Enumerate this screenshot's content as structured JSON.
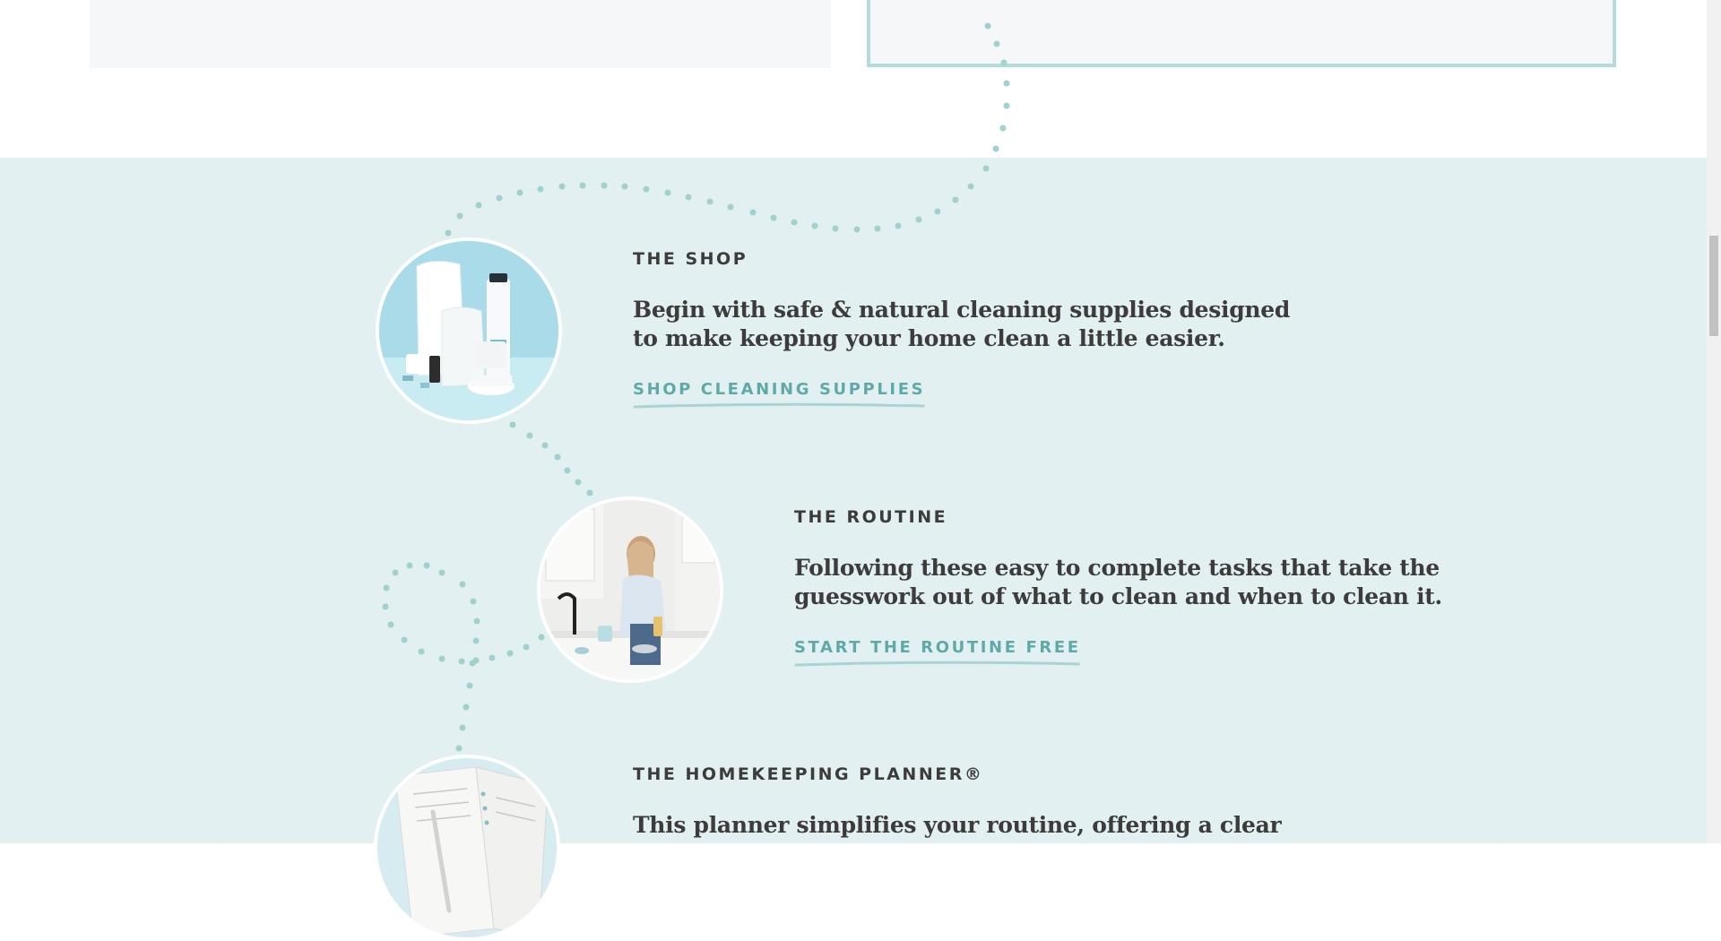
{
  "colors": {
    "section_bg": "#e2f0f1",
    "card_bg": "#f6f7f8",
    "card_border": "#b3dcdd",
    "dots": "#9fd1cf",
    "heading": "#3d3b3c",
    "link": "#5faaa9"
  },
  "steps": [
    {
      "eyebrow": "THE SHOP",
      "description_line1": "Begin with safe & natural cleaning supplies designed",
      "description_line2": "to make keeping your home clean a little easier.",
      "link_label": "SHOP CLEANING SUPPLIES",
      "image": "cleaning-products-photo"
    },
    {
      "eyebrow": "THE ROUTINE",
      "description_line1": "Following these easy to complete tasks that take the",
      "description_line2": "guesswork out of what to clean and when to clean it.",
      "link_label": "START THE ROUTINE FREE",
      "image": "woman-cleaning-kitchen-photo"
    },
    {
      "eyebrow": "THE HOMEKEEPING PLANNER®",
      "description_line1": "This planner simplifies your routine, offering a clear",
      "image": "planner-photo"
    }
  ]
}
